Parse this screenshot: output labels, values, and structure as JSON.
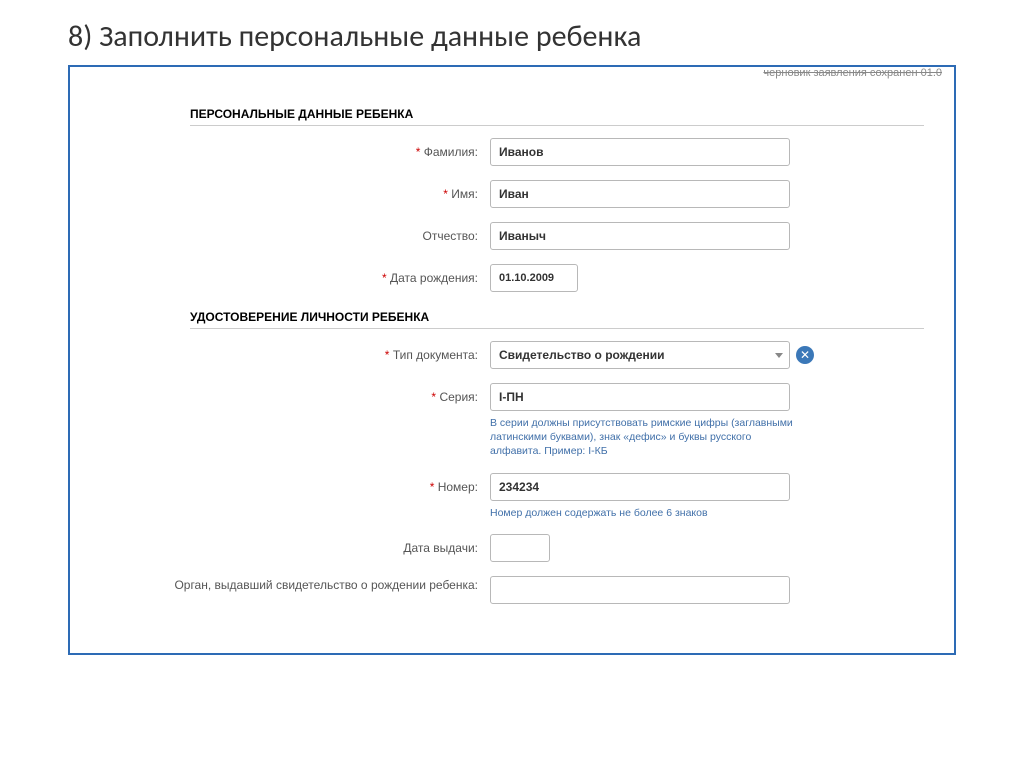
{
  "slide": {
    "title": "8) Заполнить персональные данные ребенка"
  },
  "draft_notice": "черновик заявления сохранен 01.0",
  "sections": {
    "personal": {
      "header": "ПЕРСОНАЛЬНЫЕ ДАННЫЕ РЕБЕНКА",
      "fields": {
        "surname": {
          "label": "Фамилия:",
          "value": "Иванов",
          "required": true
        },
        "firstname": {
          "label": "Имя:",
          "value": "Иван",
          "required": true
        },
        "patronymic": {
          "label": "Отчество:",
          "value": "Иваныч",
          "required": false
        },
        "birthdate": {
          "label": "Дата рождения:",
          "value": "01.10.2009",
          "required": true
        }
      }
    },
    "identity": {
      "header": "УДОСТОВЕРЕНИЕ ЛИЧНОСТИ РЕБЕНКА",
      "fields": {
        "doctype": {
          "label": "Тип документа:",
          "value": "Свидетельство о рождении",
          "required": true
        },
        "series": {
          "label": "Серия:",
          "value": "I-ПН",
          "required": true,
          "hint": "В серии должны присутствовать римские цифры (заглавными латинскими буквами), знак «дефис» и буквы русского алфавита. Пример: I-КБ"
        },
        "number": {
          "label": "Номер:",
          "value": "234234",
          "required": true,
          "hint": "Номер должен содержать не более 6 знаков"
        },
        "issuedate": {
          "label": "Дата выдачи:",
          "value": "",
          "required": false
        },
        "issuer": {
          "label": "Орган, выдавший свидетельство о рождении ребенка:",
          "value": "",
          "required": false
        }
      }
    }
  },
  "required_marker": "*"
}
